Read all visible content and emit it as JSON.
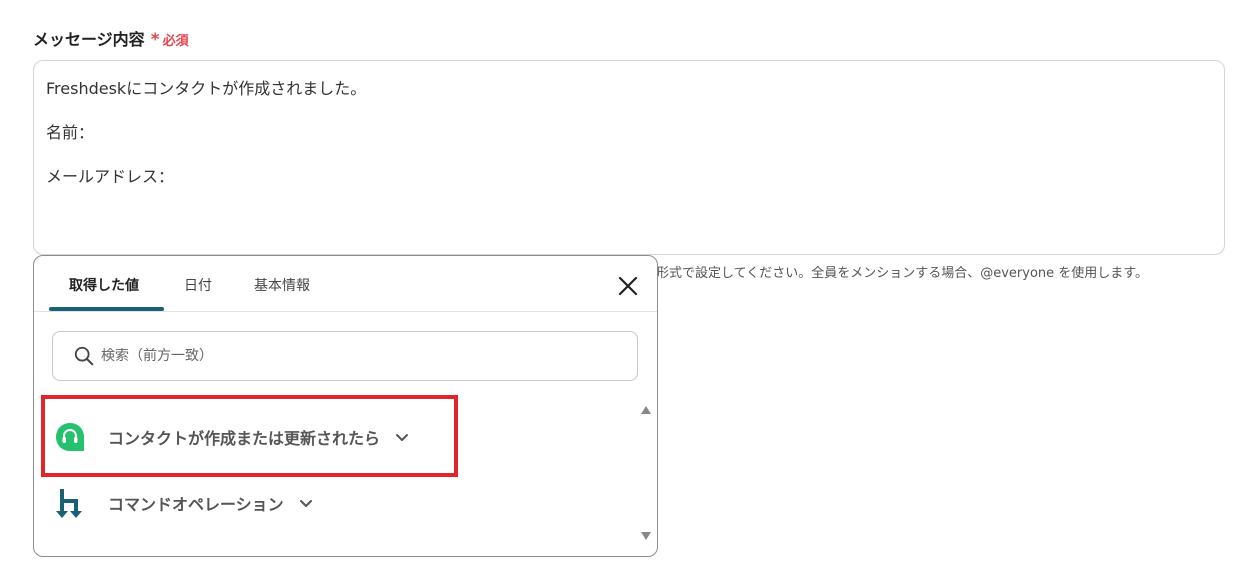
{
  "field": {
    "label": "メッセージ内容",
    "required_mark": "*",
    "required_text": "必須"
  },
  "message": {
    "lines": [
      "Freshdeskにコンタクトが作成されました。",
      "名前：",
      "メールアドレス："
    ]
  },
  "help_text": "形式で設定してください。全員をメンションする場合、@everyone を使用します。",
  "popup": {
    "tabs": [
      "取得した値",
      "日付",
      "基本情報"
    ],
    "active_tab": 0,
    "search": {
      "placeholder": "検索（前方一致）",
      "value": ""
    },
    "items": [
      {
        "label": "コンタクトが作成または更新されたら",
        "icon": "freshdesk-headset-icon",
        "color": "#25c16f"
      },
      {
        "label": "コマンドオペレーション",
        "icon": "yoom-command-icon",
        "color": "#1a6176"
      }
    ]
  },
  "colors": {
    "required": "#e8464f",
    "tab_accent": "#1a6176",
    "highlight": "#e0262a"
  }
}
